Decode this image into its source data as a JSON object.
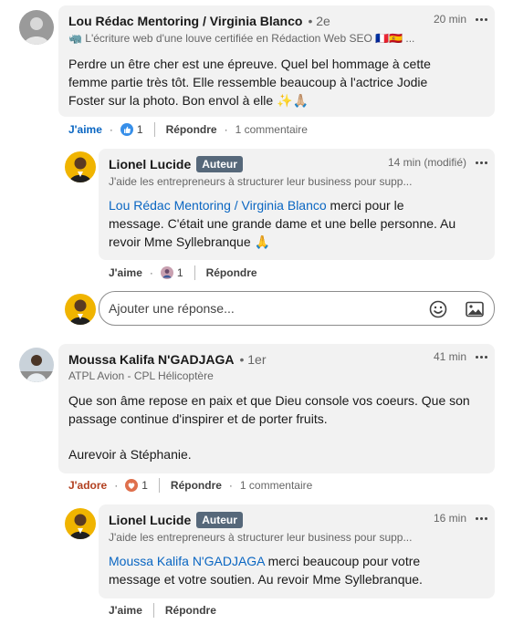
{
  "comments": [
    {
      "author": "Lou Rédac Mentoring / Virginia Blanco",
      "degree": "• 2e",
      "headline": "🦏 L'écriture web d'une louve certifiée en Rédaction Web SEO 🇫🇷🇪🇸 ...",
      "time": "20 min",
      "text": "Perdre un être cher est une épreuve. Quel bel hommage à cette femme partie très tôt. Elle ressemble beaucoup à l'actrice Jodie Foster sur la photo. Bon envol à elle ✨🙏🏼",
      "reaction_label": "J'aime",
      "reaction_count": "1",
      "reply_label": "Répondre",
      "comments_count": "1 commentaire",
      "reaction_icon": "like-icon",
      "reply": {
        "author": "Lionel Lucide",
        "badge": "Auteur",
        "headline": "J'aide les entrepreneurs à structurer leur business pour supp...",
        "time": "14 min (modifié)",
        "mention": "Lou Rédac Mentoring / Virginia Blanco",
        "text_line1": " merci pour le",
        "text_line2": "message. C'était une grande dame et une belle personne. Au",
        "text_line3": "revoir Mme Syllebranque 🙏",
        "reaction_label": "J'aime",
        "reaction_count": "1",
        "reply_label": "Répondre"
      }
    },
    {
      "author": "Moussa Kalifa N'GADJAGA",
      "degree": "• 1er",
      "headline": "ATPL Avion - CPL Hélicoptère",
      "time": "41 min",
      "text_line1": "Que son âme repose en paix et que Dieu console vos coeurs. Que son",
      "text_line2": "passage continue d'inspirer et de porter fruits.",
      "text_line3": "Aurevoir à Stéphanie.",
      "reaction_label": "J'adore",
      "reaction_count": "1",
      "reply_label": "Répondre",
      "comments_count": "1 commentaire",
      "reaction_icon": "heart-icon",
      "reply": {
        "author": "Lionel Lucide",
        "badge": "Auteur",
        "headline": "J'aide les entrepreneurs à structurer leur business pour supp...",
        "time": "16 min",
        "mention": "Moussa Kalifa N'GADJAGA",
        "text_line1": " merci beaucoup pour votre",
        "text_line2": "message et votre soutien. Au revoir Mme Syllebranque.",
        "reaction_label": "J'aime",
        "reply_label": "Répondre"
      }
    }
  ],
  "reply_input": {
    "placeholder": "Ajouter une réponse..."
  },
  "colors": {
    "link": "#0a66c2",
    "bubble": "#f2f2f2",
    "badge": "#56687a",
    "adore": "#b24020"
  }
}
